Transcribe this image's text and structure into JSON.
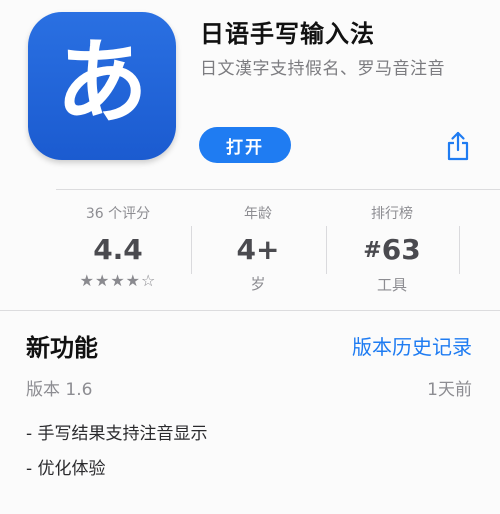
{
  "app": {
    "icon_glyph": "あ",
    "icon_color": "#2a70e2",
    "title": "日语手写输入法",
    "subtitle": "日文漢字支持假名、罗马音注音",
    "open_label": "打开",
    "share_icon": "share-icon",
    "accent_color": "#1f7cf2"
  },
  "stats": {
    "ratings": {
      "label": "36 个评分",
      "value": "4.4",
      "stars": "★★★★☆",
      "star_rating": 4.4
    },
    "age": {
      "label": "年龄",
      "value": "4+",
      "sub": "岁"
    },
    "rank": {
      "label": "排行榜",
      "hash": "#",
      "value": "63",
      "sub": "工具"
    }
  },
  "whats_new": {
    "title": "新功能",
    "history_link": "版本历史记录",
    "version": "版本 1.6",
    "date": "1天前",
    "notes": [
      "- 手写结果支持注音显示",
      "- 优化体验"
    ]
  }
}
